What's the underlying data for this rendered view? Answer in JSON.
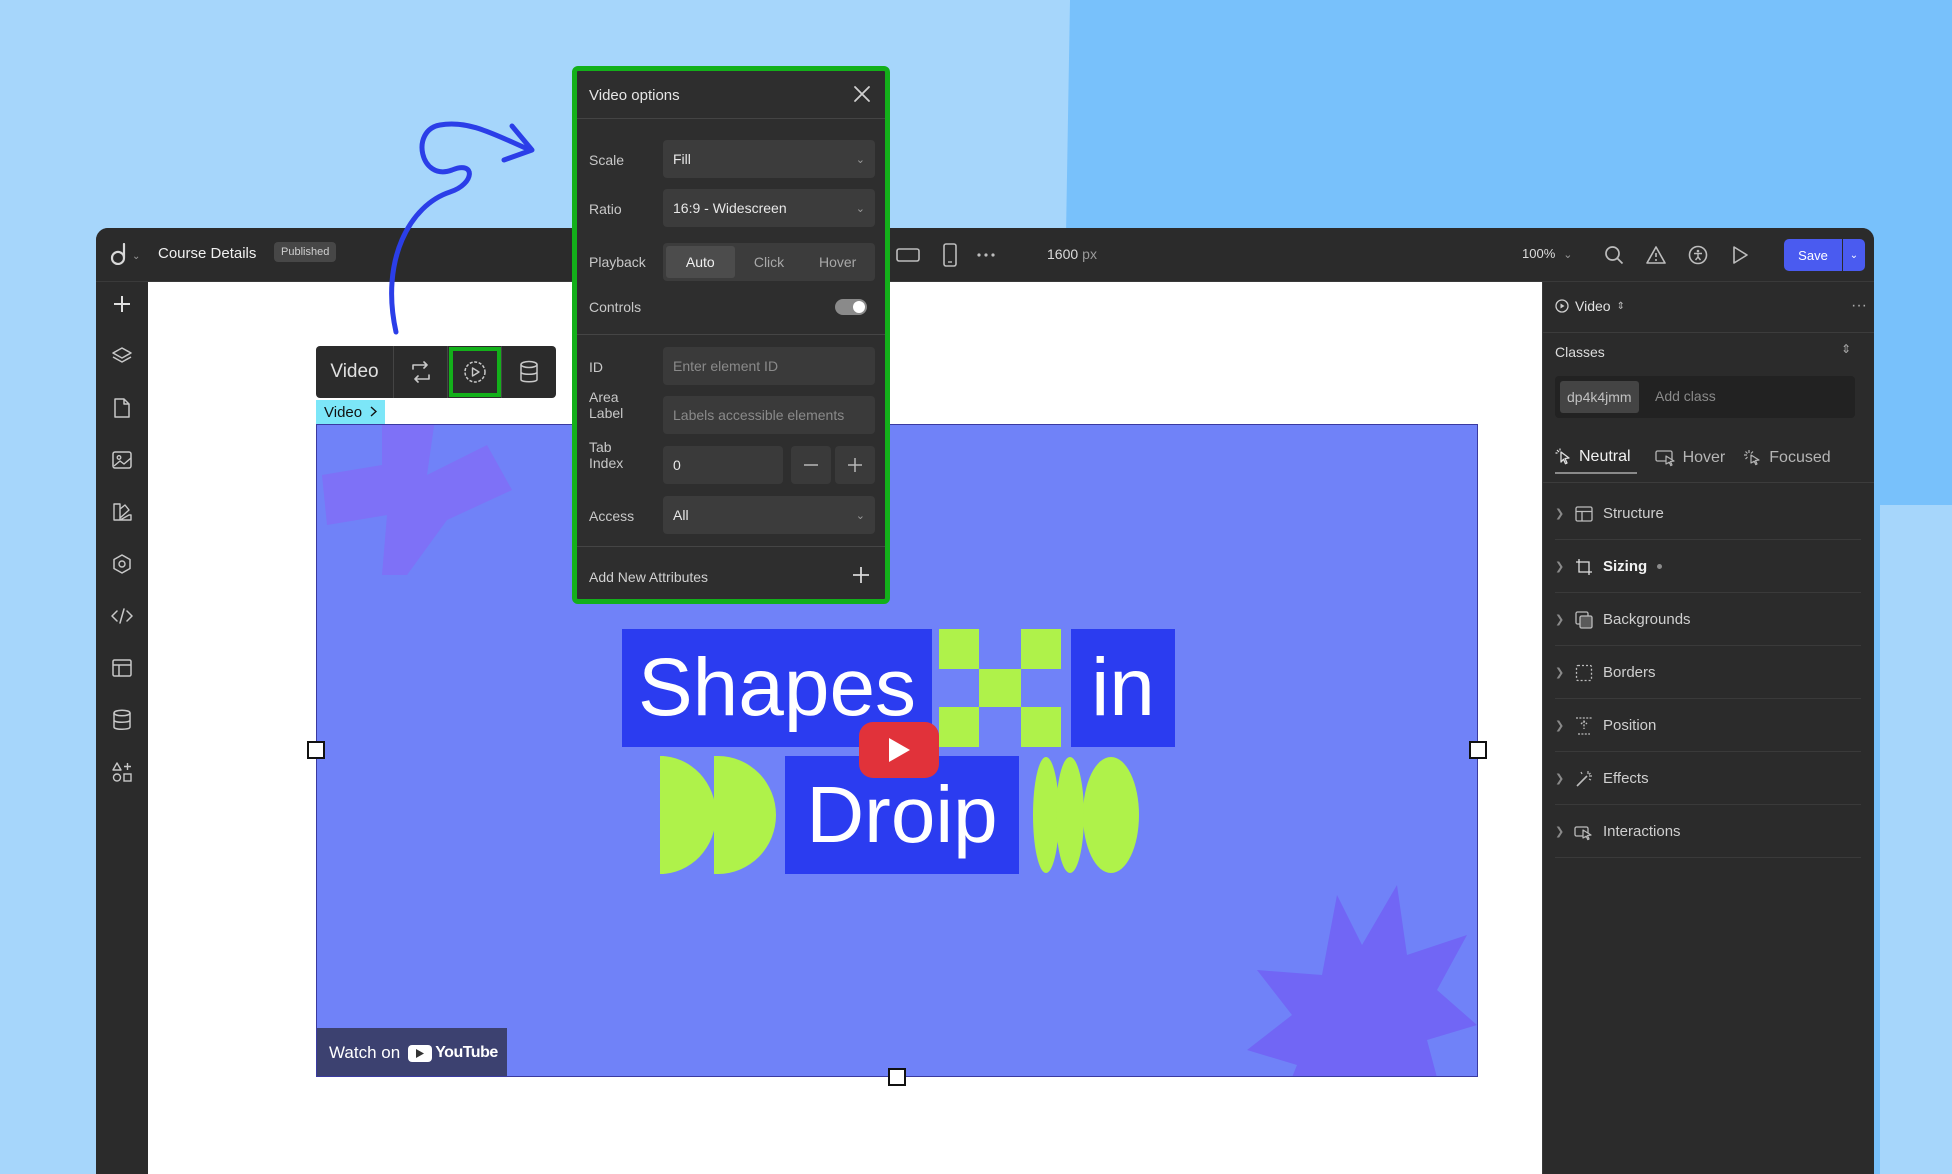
{
  "app": {
    "page_title": "Course Details",
    "status_badge": "Published",
    "viewport_width": "1600",
    "viewport_unit": "px",
    "zoom": "100%",
    "save_label": "Save",
    "accent_color": "#4a5bf0"
  },
  "element_toolbar": {
    "label": "Video",
    "tag_label": "Video"
  },
  "video": {
    "title_word_1": "Shapes",
    "title_word_2": "in",
    "title_word_3": "Droip",
    "watch_on": "Watch on",
    "youtube": "YouTube"
  },
  "popup": {
    "title": "Video options",
    "scale_label": "Scale",
    "scale_value": "Fill",
    "ratio_label": "Ratio",
    "ratio_value": "16:9 - Widescreen",
    "playback_label": "Playback",
    "playback_options": [
      "Auto",
      "Click",
      "Hover"
    ],
    "playback_selected": "Auto",
    "controls_label": "Controls",
    "controls_on": true,
    "id_label": "ID",
    "id_placeholder": "Enter element ID",
    "area_label_1": "Area",
    "area_label_2": "Label",
    "area_placeholder": "Labels accessible elements",
    "tab_label_1": "Tab",
    "tab_label_2": "Index",
    "tab_value": "0",
    "access_label": "Access",
    "access_value": "All",
    "add_attr_label": "Add New Attributes",
    "highlight_color": "#13b01a"
  },
  "right_panel": {
    "element_name": "Video",
    "classes_label": "Classes",
    "class_chip": "dp4k4jmm",
    "add_class_placeholder": "Add class",
    "states": [
      "Neutral",
      "Hover",
      "Focused"
    ],
    "sections": [
      "Structure",
      "Sizing",
      "Backgrounds",
      "Borders",
      "Position",
      "Effects",
      "Interactions"
    ]
  }
}
